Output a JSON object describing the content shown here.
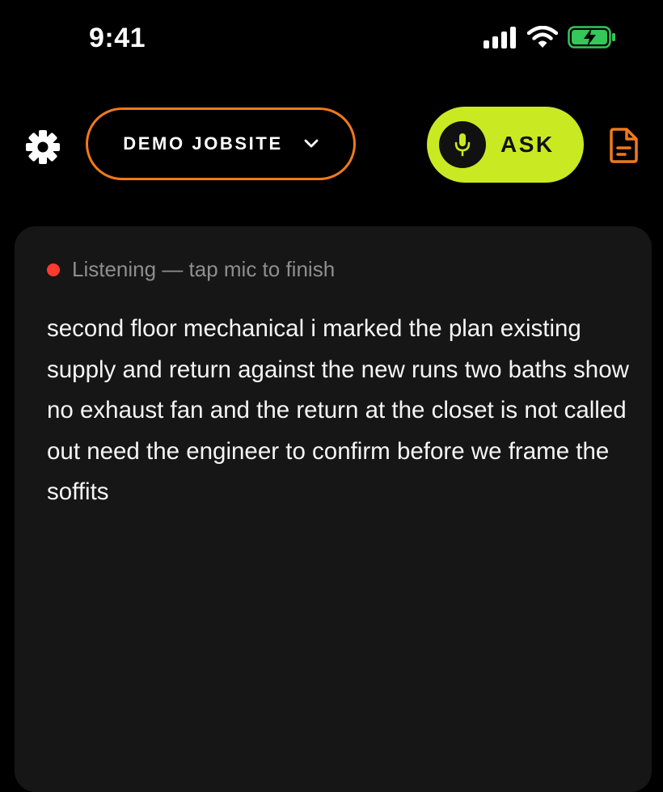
{
  "status_bar": {
    "time": "9:41",
    "icons": [
      "cellular-signal-icon",
      "wifi-icon",
      "battery-charging-icon"
    ],
    "battery_color": "#34c759"
  },
  "toolbar": {
    "settings_icon": "gear-icon",
    "jobsite_label": "DEMO JOBSITE",
    "jobsite_border_color": "#f07a1a",
    "ask_label": "ASK",
    "ask_color": "#c9ea22",
    "doc_icon": "document-icon"
  },
  "transcript_card": {
    "status_text": "Listening — tap mic to finish",
    "status_dot_color": "#ff3b30",
    "text": "second floor mechanical i marked the plan existing supply and return against the new runs two baths show no exhaust fan and the return at the closet is not called out need the engineer to confirm before we frame the soffits"
  }
}
